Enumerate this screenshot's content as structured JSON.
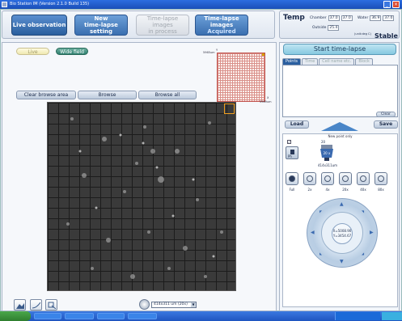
{
  "window": {
    "title": "Bio Station IM (Version 2.1.0 Build 135)"
  },
  "toolbar": {
    "live_observation": "Live observation",
    "new_timelapse_line1": "New",
    "new_timelapse_line2": "time-lapse setting",
    "in_process_line1": "Time-lapse images",
    "in_process_line2": "in process",
    "acquired_line1": "Time-lapse images",
    "acquired_line2": "Acquired"
  },
  "temp": {
    "title": "Temp",
    "chamber_label": "Chamber",
    "chamber_value": "37.0",
    "chamber_set": "37.0",
    "water_label": "Water",
    "water_value": "36.9",
    "water_set": "37.0",
    "outside_label": "Outside",
    "outside_value": "25.4",
    "units_hint": "(unit:deg C)",
    "status": "Stable"
  },
  "view": {
    "live_label": "Live",
    "wide_field_label": "Wide field",
    "clear_browse_area": "Clear browse area",
    "browse": "Browse",
    "browse_all": "Browse all",
    "minimap_y_label": "Y",
    "minimap_y_value": "5965um",
    "minimap_x_label": "X",
    "minimap_x_value": "5989um",
    "zoom_select_value": "414x311 um (20x)"
  },
  "right": {
    "start_timelapse": "Start time-lapse",
    "tabs": [
      {
        "label": "Points",
        "active": true
      },
      {
        "label": "Time",
        "active": false
      },
      {
        "label": "Cell name etc.",
        "active": false
      },
      {
        "label": "Block",
        "active": false
      }
    ],
    "clear": "Clear",
    "load": "Load",
    "save": "Save",
    "new_point_only": "New point only",
    "ph_label": "Ph",
    "lens_label": "20 x",
    "lens_value": "20",
    "lens_size": "414x311um",
    "objectives": [
      {
        "label": "Full"
      },
      {
        "label": "2x"
      },
      {
        "label": "4x"
      },
      {
        "label": "20x"
      },
      {
        "label": "40x"
      },
      {
        "label": "80x"
      }
    ],
    "stage_x": "X=5008.90",
    "stage_y": "Y=3454.67"
  },
  "colors": {
    "accent_blue": "#2a5fa0",
    "status_ok": "#1a2a4a",
    "minimap_grid": "#c0504a",
    "selected_tile": "#f0a020"
  }
}
